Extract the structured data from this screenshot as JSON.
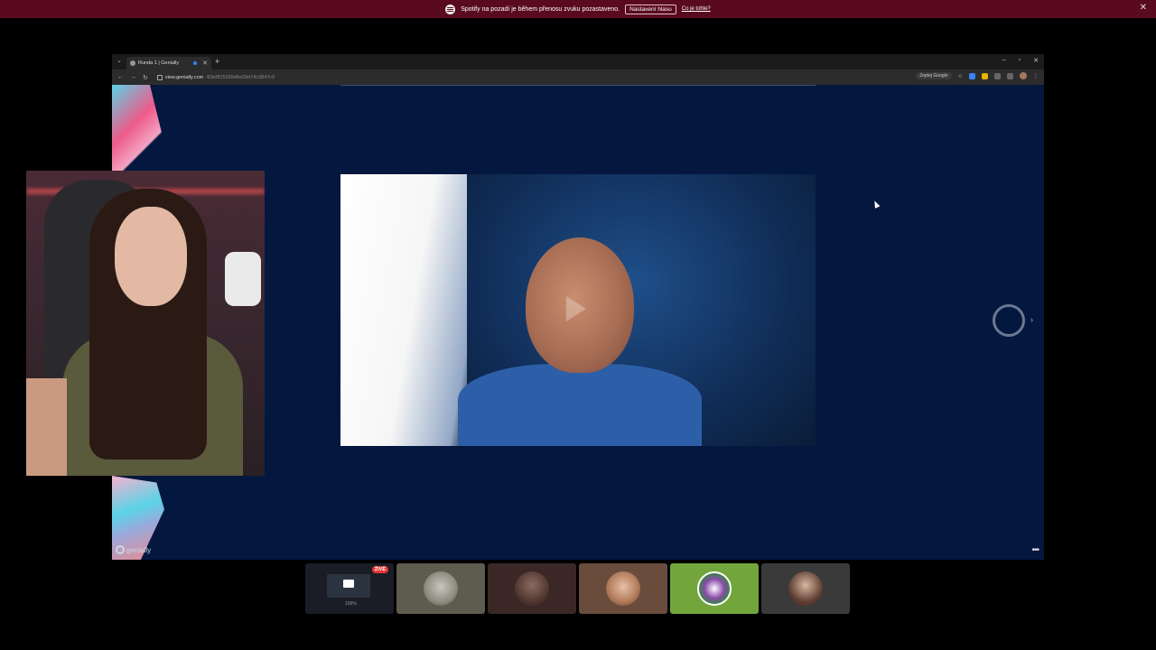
{
  "notification": {
    "app_icon": "spotify-icon",
    "message": "Spotify na pozadí je během přenosu zvuku pozastaveno.",
    "button_label": "Nastavení hlasu",
    "link_label": "Co je tohle?",
    "close_glyph": "✕"
  },
  "browser": {
    "menu_glyph": "⌄",
    "tab_title": "Runda 1 | Genially",
    "tab_close_glyph": "✕",
    "new_tab_glyph": "+",
    "window_controls": [
      "–",
      "▫",
      "✕"
    ],
    "nav": {
      "back": "←",
      "forward": "→",
      "reload": "↻"
    },
    "url_host": "view.genially.com",
    "url_path": "/63e8f15269d6e29d74c3847c9",
    "google_button": "Zeptej Google",
    "star_glyph": "☆",
    "kebab_glyph": "⋮"
  },
  "page": {
    "next_arrow": "›",
    "brand_label": "genially",
    "more_glyph": "•••"
  },
  "strip": {
    "live_badge": "ŽIVĚ",
    "screen_sub": "100%"
  },
  "colors": {
    "notification_bg": "#5a0a1f",
    "page_bg": "#04173f",
    "live_badge": "#e53935",
    "accent_green": "#72a63c"
  }
}
